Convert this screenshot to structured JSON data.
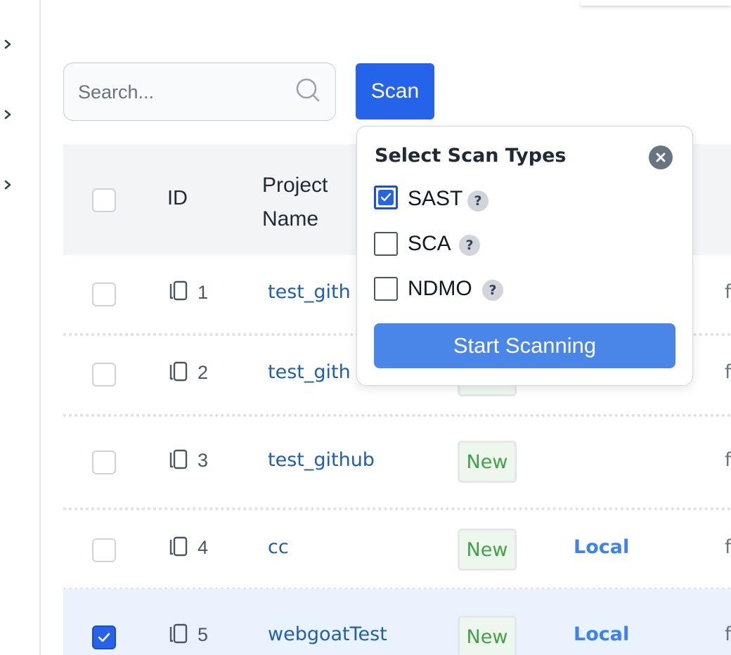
{
  "search": {
    "placeholder": "Search..."
  },
  "toolbar": {
    "scan_label": "Scan"
  },
  "table": {
    "headers": {
      "id": "ID",
      "project_line1": "Project",
      "project_line2": "Name"
    },
    "rows": [
      {
        "id": "1",
        "project": "test_gith",
        "status": "",
        "source": "",
        "cut": "f",
        "checked": false
      },
      {
        "id": "2",
        "project": "test_gith",
        "status": "",
        "source": "",
        "cut": "f",
        "checked": false
      },
      {
        "id": "3",
        "project": "test_github",
        "status": "New",
        "source": "",
        "cut": "f",
        "checked": false
      },
      {
        "id": "4",
        "project": "cc",
        "status": "New",
        "source": "Local",
        "cut": "f",
        "checked": false
      },
      {
        "id": "5",
        "project": "webgoatTest",
        "status": "New",
        "source": "Local",
        "cut": "f",
        "checked": true
      }
    ]
  },
  "popover": {
    "title": "Select Scan Types",
    "options": [
      {
        "label": "SAST",
        "checked": true,
        "help": "?"
      },
      {
        "label": "SCA",
        "checked": false,
        "help": "?"
      },
      {
        "label": "NDMO",
        "checked": false,
        "help": "?"
      }
    ],
    "start_label": "Start Scanning"
  },
  "colors": {
    "accent": "#2563eb",
    "link": "#1e5eb5",
    "status_new": "#43a047",
    "source_link": "#3b82f6"
  }
}
